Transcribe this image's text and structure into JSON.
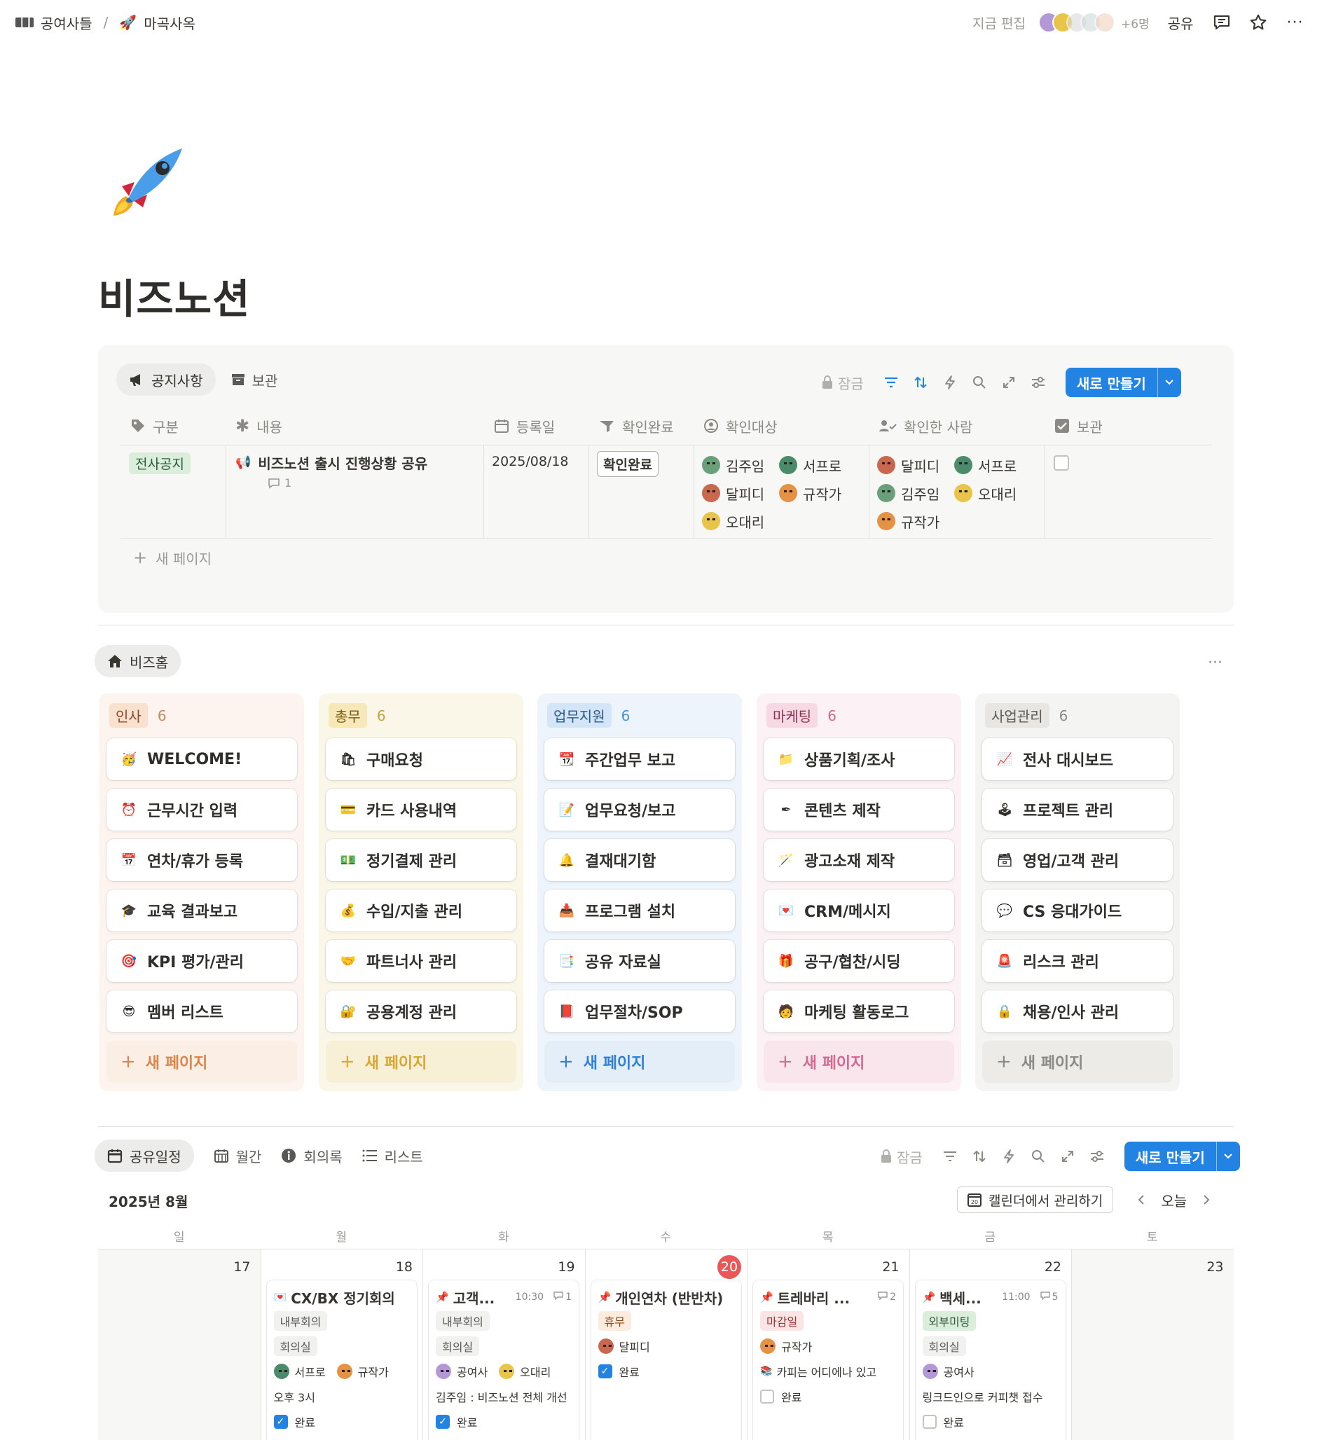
{
  "breadcrumb": {
    "workspace": "공여사들",
    "page": "마곡사옥"
  },
  "topbar": {
    "editing": "지금 편집",
    "more_count": "+6명",
    "share": "공유"
  },
  "page": {
    "title": "비즈노션"
  },
  "notice": {
    "tabs": [
      "공지사항",
      "보관"
    ],
    "toolbar": {
      "lock": "잠금",
      "new": "새로 만들기"
    },
    "columns": [
      "구분",
      "내용",
      "등록일",
      "확인완료",
      "확인대상",
      "확인한 사람",
      "보관"
    ],
    "row": {
      "category": "전사공지",
      "content": "비즈노션 출시 진행상황 공유",
      "comments": "1",
      "date": "2025/08/18",
      "confirmed": "확인완료",
      "targets": [
        "김주임",
        "서프로",
        "달피디",
        "규작가",
        "오대리"
      ],
      "confirmers": [
        "달피디",
        "서프로",
        "김주임",
        "오대리",
        "규작가"
      ]
    },
    "new_page": "새 페이지"
  },
  "bizhome": {
    "tab": "비즈홈",
    "columns": [
      {
        "name": "인사",
        "count": "6",
        "items": [
          "WELCOME!",
          "근무시간 입력",
          "연차/휴가 등록",
          "교육 결과보고",
          "KPI 평가/관리",
          "멤버 리스트"
        ],
        "icons": [
          "🥳",
          "⏰",
          "📅",
          "🎓",
          "🎯",
          "😎"
        ]
      },
      {
        "name": "총무",
        "count": "6",
        "items": [
          "구매요청",
          "카드 사용내역",
          "정기결제 관리",
          "수입/지출 관리",
          "파트너사 관리",
          "공용계정 관리"
        ],
        "icons": [
          "🛍",
          "💳",
          "💵",
          "💰",
          "🤝",
          "🔐"
        ]
      },
      {
        "name": "업무지원",
        "count": "6",
        "items": [
          "주간업무 보고",
          "업무요청/보고",
          "결재대기함",
          "프로그램 설치",
          "공유 자료실",
          "업무절차/SOP"
        ],
        "icons": [
          "📆",
          "📝",
          "🔔",
          "📥",
          "📑",
          "📕"
        ]
      },
      {
        "name": "마케팅",
        "count": "6",
        "items": [
          "상품기획/조사",
          "콘텐츠 제작",
          "광고소재 제작",
          "CRM/메시지",
          "공구/협찬/시딩",
          "마케팅 활동로그"
        ],
        "icons": [
          "📁",
          "✒",
          "🪄",
          "💌",
          "🎁",
          "🧑"
        ]
      },
      {
        "name": "사업관리",
        "count": "6",
        "items": [
          "전사 대시보드",
          "프로젝트 관리",
          "영업/고객 관리",
          "CS 응대가이드",
          "리스크 관리",
          "채용/인사 관리"
        ],
        "icons": [
          "📈",
          "🕹",
          "🗃",
          "💬",
          "🚨",
          "🔒"
        ]
      }
    ],
    "new_page": "새 페이지"
  },
  "schedule": {
    "tabs": [
      "공유일정",
      "월간",
      "회의록",
      "리스트"
    ],
    "toolbar": {
      "lock": "잠금",
      "new": "새로 만들기"
    },
    "month": "2025년 8월",
    "manage": "캘린더에서 관리하기",
    "today": "오늘",
    "weekdays": [
      "일",
      "월",
      "화",
      "수",
      "목",
      "금",
      "토"
    ],
    "days": [
      "17",
      "18",
      "19",
      "20",
      "21",
      "22",
      "23"
    ],
    "events": [
      {
        "title": "CX/BX 정기회의",
        "tags": [
          "내부회의",
          "회의실"
        ],
        "people": [
          "서프로",
          "규작가"
        ],
        "note": "오후 3시",
        "status": "완료",
        "done": true
      },
      {
        "title": "고객...",
        "time": "10:30",
        "comments": "1",
        "tags": [
          "내부회의",
          "회의실"
        ],
        "people": [
          "공여사",
          "오대리"
        ],
        "note": "김주임 : 비즈노션 전체 개선",
        "status": "완료",
        "done": true
      },
      {
        "title": "개인연차 (반반차)",
        "tags": [
          "휴무"
        ],
        "people": [
          "달피디"
        ],
        "status": "완료",
        "done": true
      },
      {
        "title": "트레바리 ...",
        "comments": "2",
        "tags": [
          "마감일"
        ],
        "people": [
          "규작가"
        ],
        "note": "카피는 어디에나 있고",
        "status": "완료",
        "done": false
      },
      {
        "title": "백세...",
        "time": "11:00",
        "comments": "5",
        "tags": [
          "외부미팅",
          "회의실"
        ],
        "people": [
          "공여사"
        ],
        "note": "링크드인으로 커피챗 접수",
        "status": "완료",
        "done": false
      }
    ]
  },
  "colors": {
    "accent": "#2383e2",
    "today": "#eb5757"
  }
}
